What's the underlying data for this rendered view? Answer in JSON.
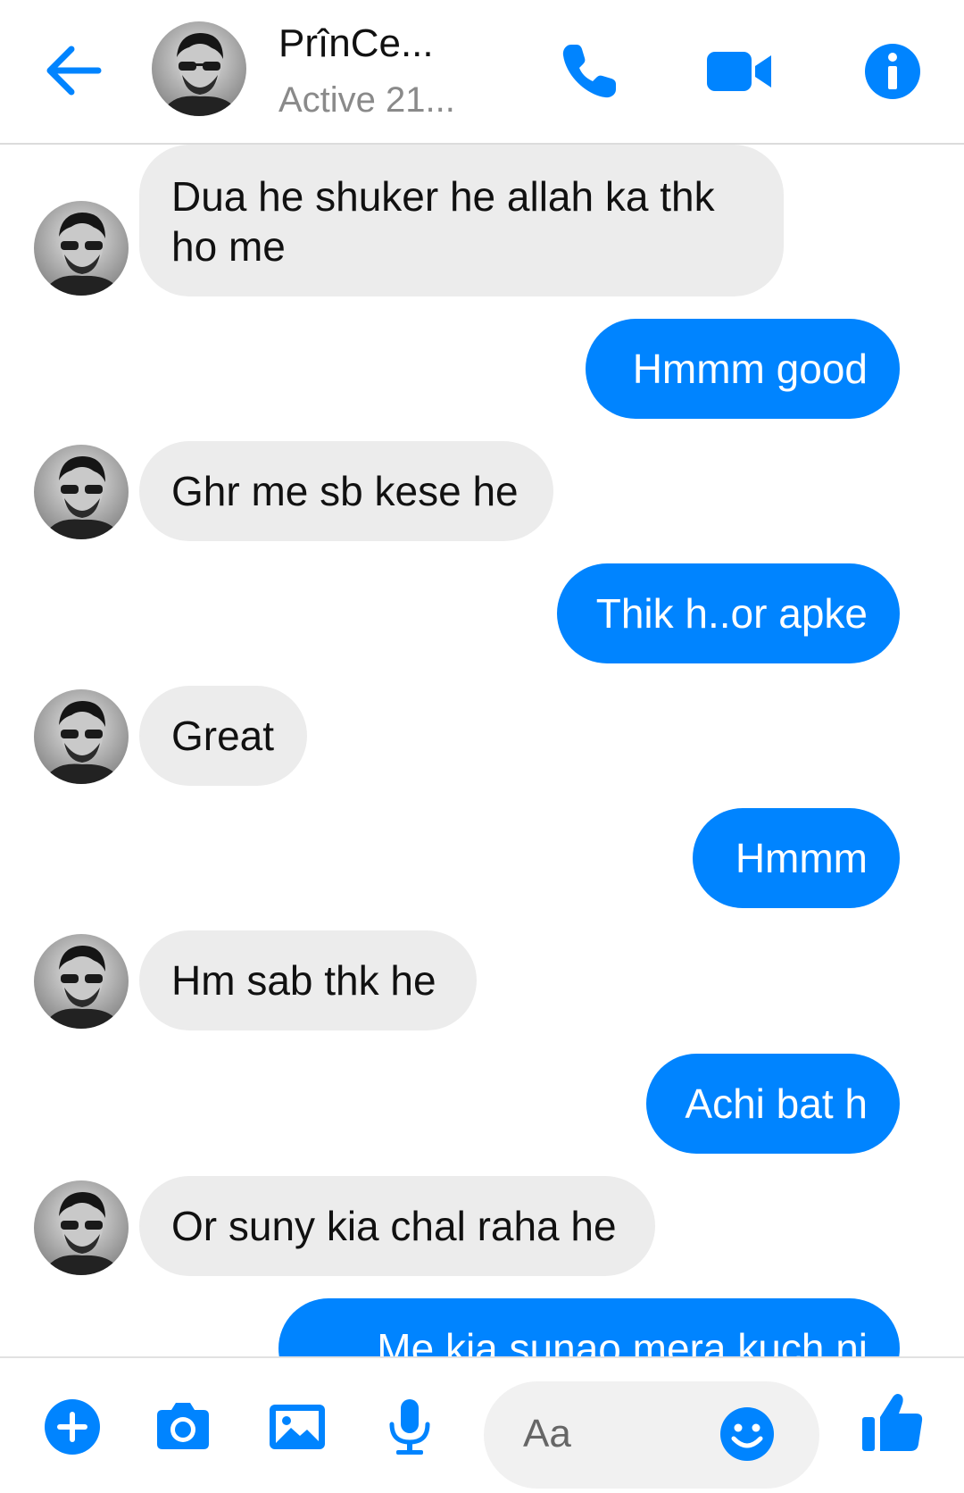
{
  "header": {
    "contact_name": "PrînCe...",
    "status": "Active 21...",
    "accent_color": "#0084ff"
  },
  "icons": {
    "back": "arrow-left-icon",
    "call": "phone-icon",
    "video": "video-camera-icon",
    "info": "info-icon",
    "add": "plus-circle-icon",
    "camera": "camera-icon",
    "gallery": "image-icon",
    "mic": "microphone-icon",
    "emoji": "smiley-icon",
    "like": "thumbs-up-icon"
  },
  "messages": [
    {
      "from": "them",
      "lines": [
        "Dua he shuker he allah ka thk",
        "ho me"
      ]
    },
    {
      "from": "me",
      "lines": [
        "Hmmm good"
      ]
    },
    {
      "from": "them",
      "lines": [
        "Ghr me sb kese he"
      ]
    },
    {
      "from": "me",
      "lines": [
        "Thik h..or apke"
      ]
    },
    {
      "from": "them",
      "lines": [
        "Great"
      ]
    },
    {
      "from": "me",
      "lines": [
        "Hmmm"
      ]
    },
    {
      "from": "them",
      "lines": [
        "Hm sab thk he"
      ]
    },
    {
      "from": "me",
      "lines": [
        "Achi bat h"
      ]
    },
    {
      "from": "them",
      "lines": [
        "Or suny kia chal raha he"
      ]
    },
    {
      "from": "me",
      "lines": [
        "Me kia sunao mera kuch ni"
      ]
    }
  ],
  "composer": {
    "placeholder": "Aa"
  }
}
